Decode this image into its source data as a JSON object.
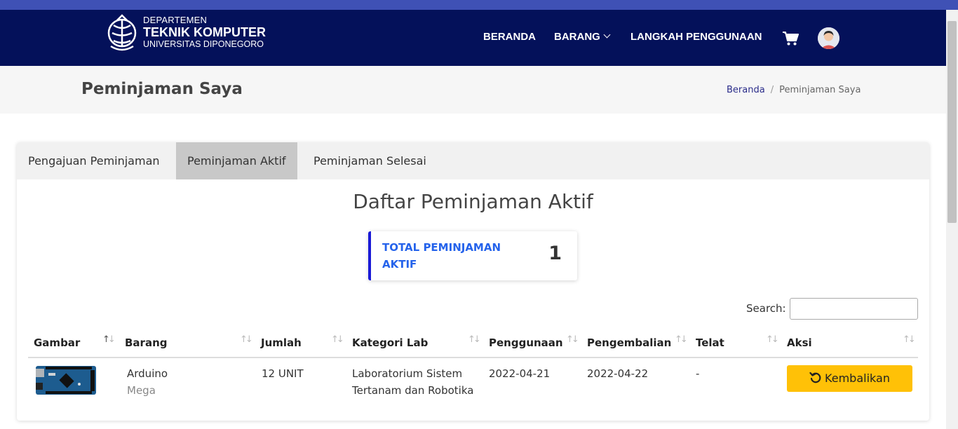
{
  "brand": {
    "line1": "DEPARTEMEN",
    "line2": "TEKNIK KOMPUTER",
    "line3": "UNIVERSITAS DIPONEGORO"
  },
  "nav": {
    "items": [
      "BERANDA",
      "BARANG",
      "LANGKAH PENGGUNAAN"
    ],
    "cart_icon": "shopping-cart-icon",
    "avatar_icon": "user-avatar"
  },
  "page": {
    "title": "Peminjaman Saya",
    "breadcrumb": [
      "Beranda",
      "Peminjaman Saya"
    ]
  },
  "tabs": [
    {
      "label": "Pengajuan Peminjaman",
      "active": false
    },
    {
      "label": "Peminjaman Aktif",
      "active": true
    },
    {
      "label": "Peminjaman Selesai",
      "active": false
    }
  ],
  "section_title": "Daftar Peminjaman Aktif",
  "stat": {
    "label": "TOTAL PEMINJAMAN AKTIF",
    "value": "1"
  },
  "search": {
    "label": "Search:",
    "value": ""
  },
  "table": {
    "columns": [
      "Gambar",
      "Barang",
      "Jumlah",
      "Kategori Lab",
      "Penggunaan",
      "Pengembalian",
      "Telat",
      "Aksi"
    ],
    "rows": [
      {
        "image": "arduino-mega-board",
        "item_name": "Arduino",
        "item_variant": "Mega",
        "quantity": "12 UNIT",
        "lab_category": "Laboratorium Sistem Tertanam dan Robotika",
        "usage_date": "2022-04-21",
        "return_date": "2022-04-22",
        "late": "-",
        "action_label": "Kembalikan",
        "action_icon": "undo-icon"
      }
    ]
  },
  "colors": {
    "navbar": "#04115a",
    "stat_accent": "#1a1ad6",
    "stat_label": "#2563eb",
    "action_button": "#ffc107"
  }
}
